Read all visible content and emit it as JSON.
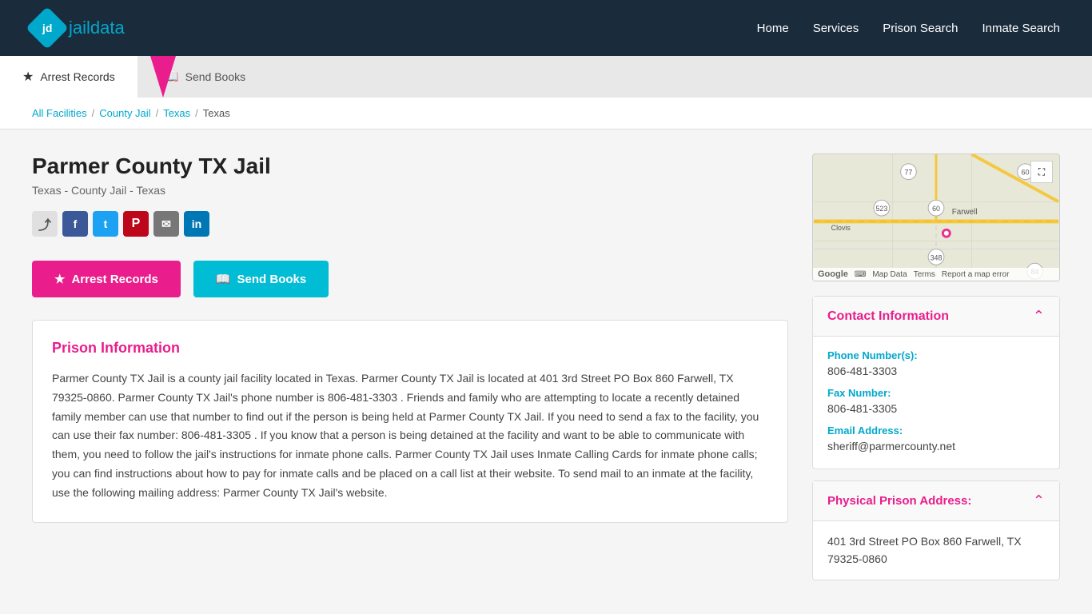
{
  "header": {
    "logo_text_jd": "jd",
    "logo_text_jail": "jail",
    "logo_text_data": "data",
    "nav": [
      {
        "label": "Home",
        "id": "home"
      },
      {
        "label": "Services",
        "id": "services"
      },
      {
        "label": "Prison Search",
        "id": "prison-search"
      },
      {
        "label": "Inmate Search",
        "id": "inmate-search"
      }
    ]
  },
  "tabs": [
    {
      "label": "Arrest Records",
      "id": "arrest-records",
      "icon": "★",
      "active": true
    },
    {
      "label": "Send Books",
      "id": "send-books",
      "icon": "📖",
      "active": false
    }
  ],
  "breadcrumb": {
    "items": [
      {
        "label": "All Facilities",
        "href": "#"
      },
      {
        "label": "County Jail",
        "href": "#"
      },
      {
        "label": "Texas",
        "href": "#"
      },
      {
        "label": "Texas",
        "current": true
      }
    ]
  },
  "facility": {
    "title": "Parmer County TX Jail",
    "subtitle": "Texas - County Jail - Texas",
    "description": "Parmer County TX Jail is a county jail facility located in Texas. Parmer County TX Jail is located at 401 3rd Street PO Box 860 Farwell, TX 79325-0860. Parmer County TX Jail's phone number is 806-481-3303 . Friends and family who are attempting to locate a recently detained family member can use that number to find out if the person is being held at Parmer County TX Jail. If you need to send a fax to the facility, you can use their fax number: 806-481-3305 . If you know that a person is being detained at the facility and want to be able to communicate with them, you need to follow the jail's instructions for inmate phone calls. Parmer County TX Jail uses Inmate Calling Cards for inmate phone calls; you can find instructions about how to pay for inmate calls and be placed on a call list at their website. To send mail to an inmate at the facility, use the following mailing address:  Parmer County TX Jail's website."
  },
  "action_buttons": {
    "arrest_records": "Arrest Records",
    "send_books": "Send Books"
  },
  "prison_info_section": {
    "title": "Prison Information"
  },
  "contact": {
    "title": "Contact Information",
    "phone_label": "Phone Number(s):",
    "phone_value": "806-481-3303",
    "fax_label": "Fax Number:",
    "fax_value": "806-481-3305",
    "email_label": "Email Address:",
    "email_value": "sheriff@parmercounty.net"
  },
  "address": {
    "title": "Physical Prison Address:",
    "line1": "401 3rd Street PO Box 860 Farwell, TX",
    "line2": "79325-0860"
  },
  "map": {
    "expand_title": "Expand map"
  }
}
